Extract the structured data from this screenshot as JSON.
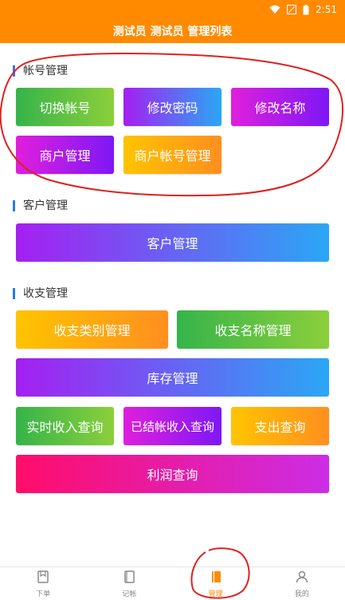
{
  "status_bar": {
    "time": "2:51"
  },
  "app_bar": {
    "title": "测试员 测试员 管理列表"
  },
  "sections": {
    "account": {
      "title": "帐号管理",
      "buttons": [
        "切换帐号",
        "修改密码",
        "修改名称",
        "商户管理",
        "商户帐号管理"
      ]
    },
    "customer": {
      "title": "客户管理",
      "buttons": [
        "客户管理"
      ]
    },
    "finance": {
      "title": "收支管理",
      "buttons": [
        "收支类别管理",
        "收支名称管理",
        "库存管理",
        "实时收入查询",
        "已结帐收入查询",
        "支出查询",
        "利润查询"
      ]
    }
  },
  "tab_bar": {
    "items": [
      {
        "label": "下单",
        "icon": "order-icon"
      },
      {
        "label": "记帐",
        "icon": "notebook-icon"
      },
      {
        "label": "管理",
        "icon": "manage-icon"
      },
      {
        "label": "我的",
        "icon": "user-icon"
      }
    ],
    "active_index": 2
  },
  "colors": {
    "accent": "#ff8a00",
    "section_bar": "#2b7be4",
    "annotation": "#e02020"
  }
}
